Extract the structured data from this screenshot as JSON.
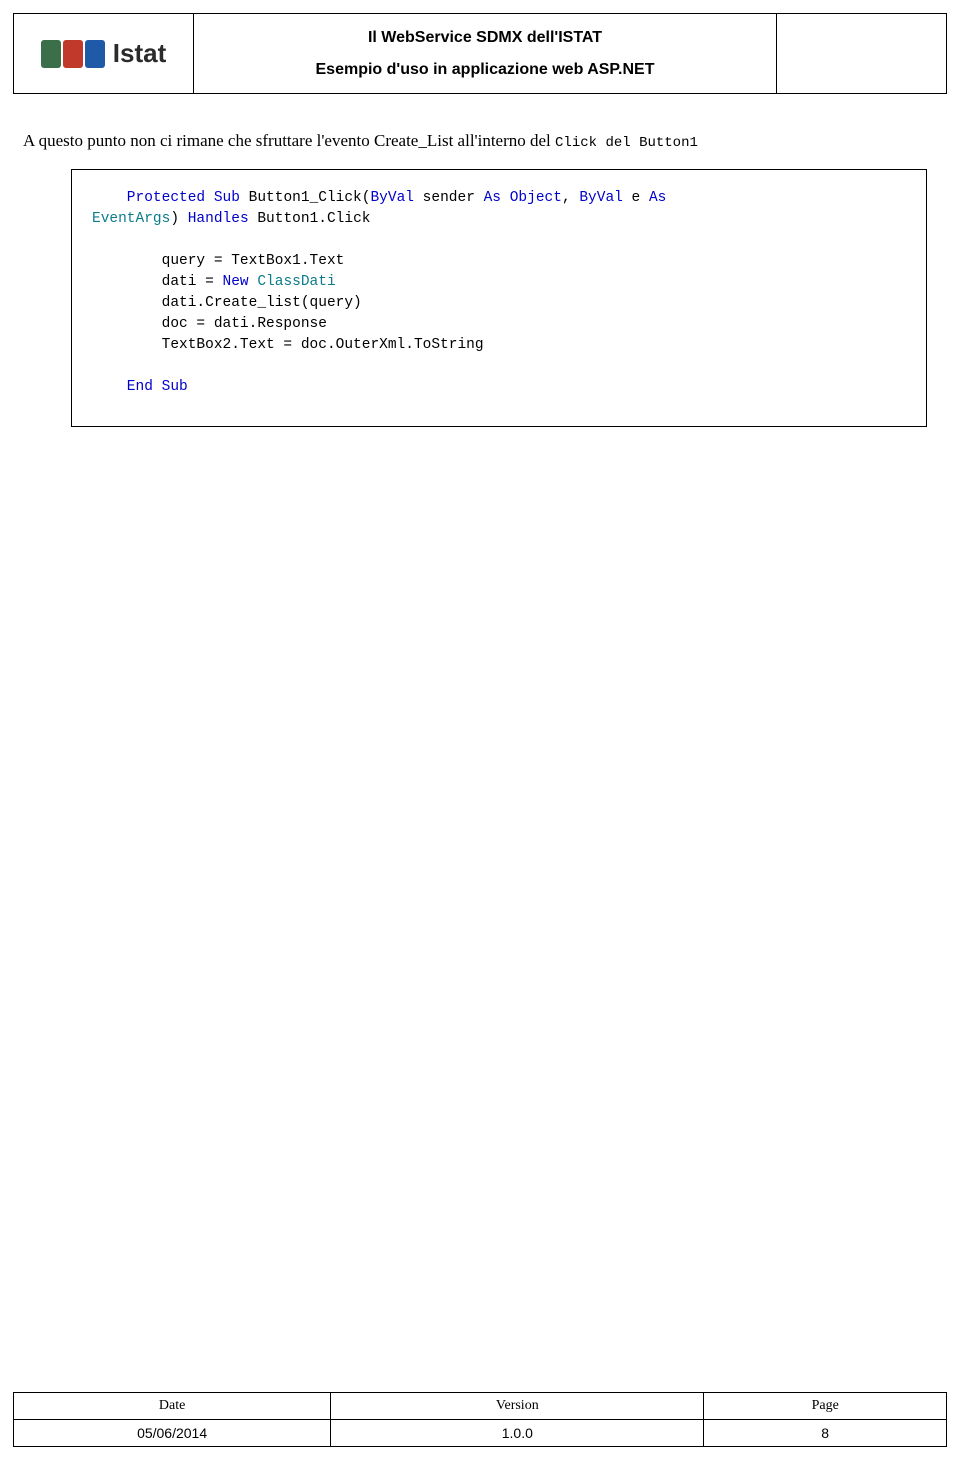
{
  "header": {
    "logo_text": "Istat",
    "title_line1": "Il WebService SDMX dell'ISTAT",
    "title_line2": "Esempio d'uso in applicazione web ASP.NET"
  },
  "body": {
    "intro_prefix": "A questo punto non ci rimane che sfruttare l'evento Create_List all'interno del ",
    "intro_code1": "Click",
    "intro_mid": " del ",
    "intro_code2": "Button1"
  },
  "code": {
    "l1_a": "    Protected",
    "l1_b": " Sub",
    "l1_c": " Button1_Click(",
    "l1_d": "ByVal",
    "l1_e": " sender ",
    "l1_f": "As",
    "l1_g": " Object",
    "l1_h": ", ",
    "l1_i": "ByVal",
    "l1_j": " e ",
    "l1_k": "As",
    "l2_a": "EventArgs",
    "l2_b": ") ",
    "l2_c": "Handles",
    "l2_d": " Button1.Click",
    "blank": "",
    "l4": "        query = TextBox1.Text",
    "l5_a": "        dati = ",
    "l5_b": "New",
    "l5_c": " ClassDati",
    "l6": "        dati.Create_list(query)",
    "l7": "        doc = dati.Response",
    "l8": "        TextBox2.Text = doc.OuterXml.ToString",
    "l10_a": "    End",
    "l10_b": " Sub"
  },
  "footer": {
    "h_date": "Date",
    "h_version": "Version",
    "h_page": "Page",
    "v_date": "05/06/2014",
    "v_version": "1.0.0",
    "v_page": "8"
  }
}
